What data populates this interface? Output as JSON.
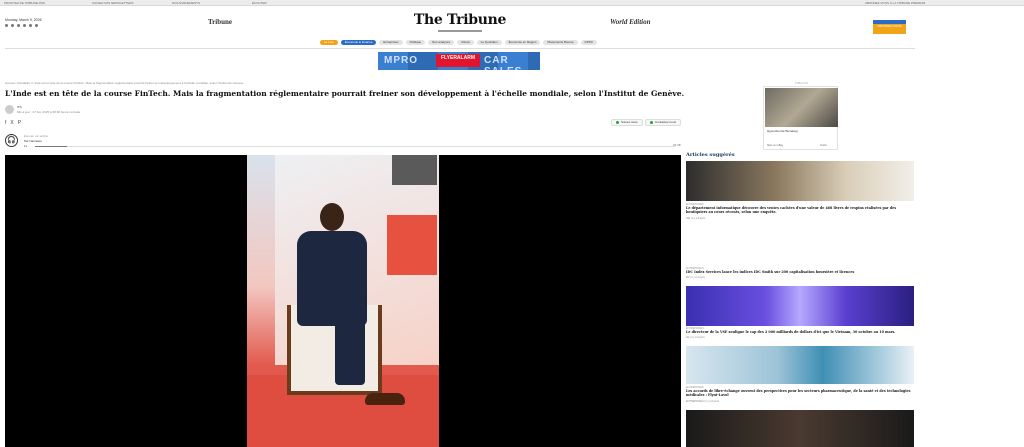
{
  "topbar": {
    "links": [
      "PROFITEZ DE TRIBUNE PRO",
      "SUIVEZ NOS NEWSLETTERS",
      "NOS ÉVÉNEMENTS",
      "ÉCOUTER",
      "ABONNEZ-VOUS À LA TRIBUNE PREMIUM"
    ]
  },
  "header": {
    "date": "Monday, March 9, 2026",
    "paper_left": "Tribune",
    "logo": "The Tribune",
    "paper_right": "World Edition",
    "subscribe": "ABONNEZ-VOUS"
  },
  "nav": {
    "items": [
      "Le Live",
      "Économie & Finance",
      "Entreprises",
      "Politique",
      "Nos analyses",
      "Climat",
      "Le Quotidien",
      "Économie en Région",
      "Placements Bourse",
      "OPINI"
    ]
  },
  "ad_banner": {
    "left_text": "MPRO",
    "brand": "FLYERALARM",
    "right_text": "CAR SALES"
  },
  "article": {
    "breadcrumb": "Accueil  /  Actualités  /  L'Inde est en tête de la course FinTech. Mais la fragmentation réglementaire pourrait freiner son développement à l'échelle mondiale, selon l'Institut de Genève.",
    "headline": "L'Inde est en tête de la course FinTech. Mais la fragmentation réglementaire pourrait freiner son développement à l'échelle mondiale, selon l'Institut de Genève.",
    "author": "ITS",
    "updated": "Mis à jour : 27 Fév 2025 à 08:00 heure normale",
    "share_icons": [
      "f",
      "X",
      "P"
    ],
    "share_button_1": "Suivez-nous",
    "share_button_2": "Contactez-nous"
  },
  "audio": {
    "label": "Écouter cet article",
    "voice": "Par Narrateur",
    "speed": "1x",
    "time": "01:48",
    "progress": 0.05
  },
  "sidebar_ad": {
    "label": "PUBLICITÉ",
    "caption": "Hyperchemie Bonebag",
    "cta": "Sites sur eBay",
    "cta_right": "Ouvrir"
  },
  "suggested": {
    "title": "Articles suggérés",
    "cards": [
      {
        "kicker": "ENTREPRISES",
        "title": "Le département informatique découvre des ventes cachées d'une valeur de 468 livres de respins réalisées par des boutiquiers au cours récents, selon une enquête.",
        "meta": "IAE  |  il y a 6 jours"
      },
      {
        "kicker": "ENTREPRISES",
        "title": "IDC Index Services lance les indices IDC Smith sur 200 capitalisation boursière et licences",
        "meta": "PR  |  il y a 2 jours"
      },
      {
        "kicker": "ENTREPRISES",
        "title": "Le directeur de la VSE souligne le cap des 2 000 milliards de dollars d'ici que le Vietnam, 30 octobre au 10 mars.",
        "meta": "AE  |  il y a 6 jours"
      },
      {
        "kicker": "ENTREPRISES",
        "title": "Les accords de libre-échange ouvrent des perspectives pour les secteurs pharmaceutique, de la santé et des technologies médicales : Flynt-Lavol",
        "meta": "ENTREPRISES  |  il y a 6 jours"
      }
    ]
  }
}
